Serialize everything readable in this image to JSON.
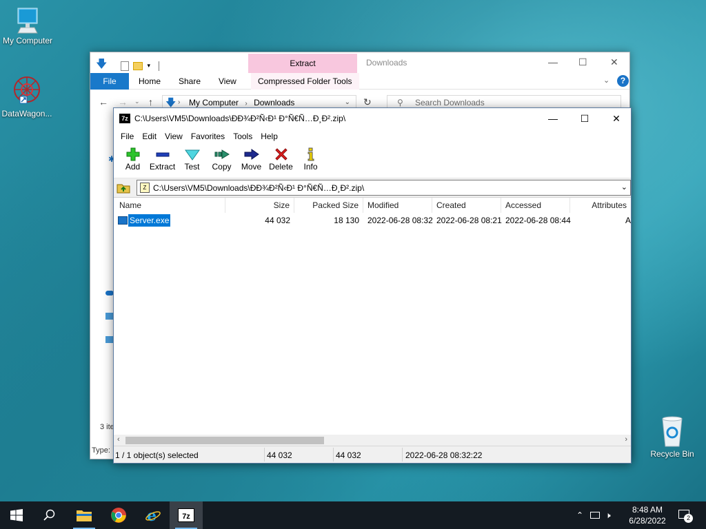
{
  "desktop": {
    "icons": [
      {
        "label": "My Computer",
        "icon": "computer-icon"
      },
      {
        "label": "DataWagon...",
        "icon": "datawagon-icon"
      },
      {
        "label": "Recycle Bin",
        "icon": "recycle-bin-icon"
      }
    ]
  },
  "explorer": {
    "title": "Downloads",
    "context_tab": "Extract",
    "context_group": "Compressed Folder Tools",
    "ribbon_tabs": [
      "File",
      "Home",
      "Share",
      "View"
    ],
    "address": {
      "root": "My Computer",
      "folder": "Downloads"
    },
    "search_placeholder": "Search Downloads",
    "item_count": "3 ite",
    "status_type": "Type:"
  },
  "sevenzip": {
    "title": "C:\\Users\\VM5\\Downloads\\ÐÐ¾Ð²Ñ‹Ð¹ Ð°Ñ€Ñ…Ð¸Ð².zip\\",
    "menu": [
      "File",
      "Edit",
      "View",
      "Favorites",
      "Tools",
      "Help"
    ],
    "toolbar": [
      {
        "label": "Add",
        "icon": "add-icon"
      },
      {
        "label": "Extract",
        "icon": "extract-icon"
      },
      {
        "label": "Test",
        "icon": "test-icon"
      },
      {
        "label": "Copy",
        "icon": "copy-icon"
      },
      {
        "label": "Move",
        "icon": "move-icon"
      },
      {
        "label": "Delete",
        "icon": "delete-icon"
      },
      {
        "label": "Info",
        "icon": "info-icon"
      }
    ],
    "path": "C:\\Users\\VM5\\Downloads\\ÐÐ¾Ð²Ñ‹Ð¹ Ð°Ñ€Ñ…Ð¸Ð².zip\\",
    "columns": [
      "Name",
      "Size",
      "Packed Size",
      "Modified",
      "Created",
      "Accessed",
      "Attributes"
    ],
    "files": [
      {
        "name": "Server.exe",
        "size": "44 032",
        "packed": "18 130",
        "modified": "2022-06-28 08:32",
        "created": "2022-06-28 08:21",
        "accessed": "2022-06-28 08:44",
        "attributes": "A"
      }
    ],
    "status": {
      "selection": "1 / 1 object(s) selected",
      "size": "44 032",
      "packed": "44 032",
      "modified": "2022-06-28 08:32:22"
    }
  },
  "taskbar": {
    "clock_time": "8:48 AM",
    "clock_date": "6/28/2022",
    "notification_count": "2"
  }
}
